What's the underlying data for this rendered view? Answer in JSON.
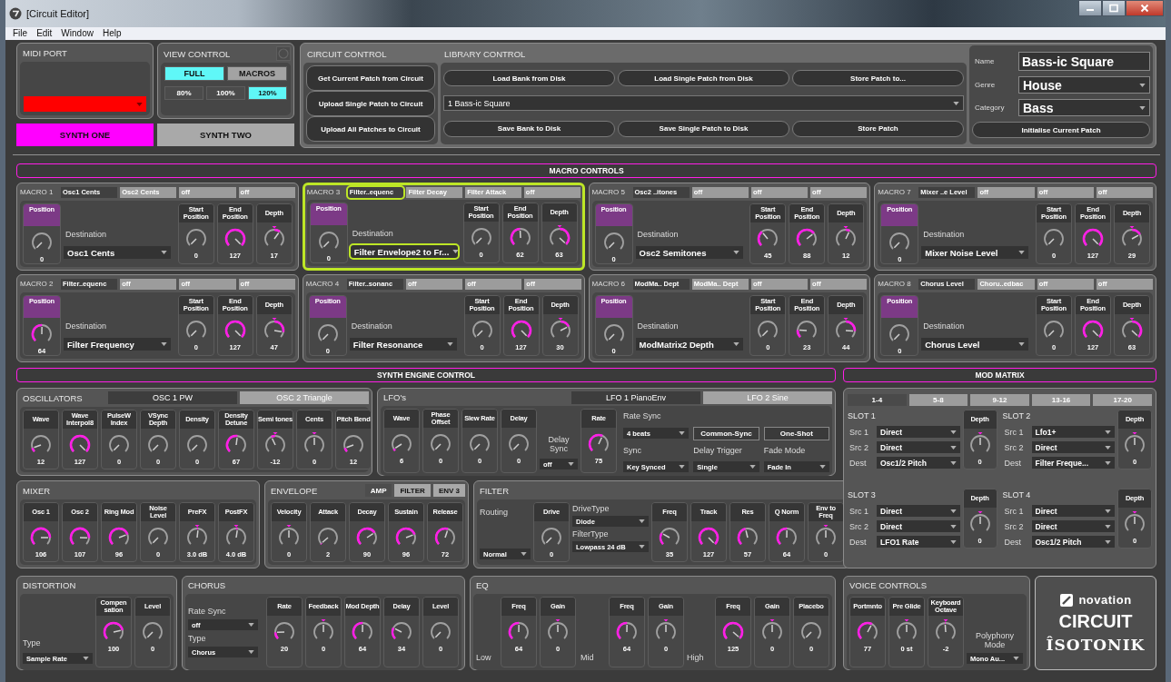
{
  "window": {
    "title": "[Circuit Editor]"
  },
  "menu": [
    "File",
    "Edit",
    "Window",
    "Help"
  ],
  "midi_port": {
    "title": "MIDI PORT"
  },
  "view_control": {
    "title": "VIEW CONTROL",
    "modes": [
      {
        "label": "FULL",
        "selected": true
      },
      {
        "label": "MACROS",
        "selected": false
      }
    ],
    "zoom": [
      {
        "label": "80%",
        "selected": false
      },
      {
        "label": "100%",
        "selected": false
      },
      {
        "label": "120%",
        "selected": true
      }
    ]
  },
  "synths": [
    {
      "label": "SYNTH ONE",
      "selected": true
    },
    {
      "label": "SYNTH TWO",
      "selected": false
    }
  ],
  "circuit_control": {
    "title": "CIRCUIT CONTROL",
    "buttons": [
      "Get Current Patch from Circuit",
      "Upload Single Patch to Circuit",
      "Upload All Patches to Circuit"
    ]
  },
  "library_control": {
    "title": "LIBRARY CONTROL",
    "buttons_top": [
      "Load Bank from Disk",
      "Load Single Patch from Disk",
      "Store Patch to..."
    ],
    "patch": "1 Bass-ic Square",
    "buttons_bottom": [
      "Save Bank to Disk",
      "Save Single Patch to Disk",
      "Store Patch"
    ]
  },
  "patch_info": {
    "name_label": "Name",
    "name": "Bass-ic Square",
    "genre_label": "Genre",
    "genre": "House",
    "category_label": "Category",
    "category": "Bass",
    "button": "Initialise Current Patch"
  },
  "macro_header": "MACRO CONTROLS",
  "macros": [
    {
      "title": "MACRO 1",
      "highlighted": false,
      "slots": [
        {
          "label": "Osc1 Cents",
          "selected": true
        },
        {
          "label": "Osc2 Cents",
          "selected": false
        },
        {
          "label": "off",
          "selected": false
        },
        {
          "label": "off",
          "selected": false
        }
      ],
      "position": {
        "label": "Position",
        "value": "0",
        "kind": "uni"
      },
      "destination_label": "Destination",
      "destination": "Osc1 Cents",
      "knobs": [
        {
          "label": "Start Position",
          "value": "0",
          "kind": "uni"
        },
        {
          "label": "End Position",
          "value": "127",
          "kind": "uni"
        },
        {
          "label": "Depth",
          "value": "17",
          "kind": "bi"
        }
      ]
    },
    {
      "title": "MACRO 3",
      "highlighted": true,
      "slots": [
        {
          "label": "Filter..equenc",
          "selected": true
        },
        {
          "label": "Filter Decay",
          "selected": false
        },
        {
          "label": "Filter Attack",
          "selected": false
        },
        {
          "label": "off",
          "selected": false
        }
      ],
      "position": {
        "label": "Position",
        "value": "0",
        "kind": "uni"
      },
      "destination_label": "Destination",
      "destination": "Filter Envelope2 to Fr...",
      "knobs": [
        {
          "label": "Start Position",
          "value": "0",
          "kind": "uni"
        },
        {
          "label": "End Position",
          "value": "62",
          "kind": "uni"
        },
        {
          "label": "Depth",
          "value": "63",
          "kind": "bi"
        }
      ]
    },
    {
      "title": "MACRO 5",
      "highlighted": false,
      "slots": [
        {
          "label": "Osc2 ..itones",
          "selected": true
        },
        {
          "label": "off",
          "selected": false
        },
        {
          "label": "off",
          "selected": false
        },
        {
          "label": "off",
          "selected": false
        }
      ],
      "position": {
        "label": "Position",
        "value": "0",
        "kind": "uni"
      },
      "destination_label": "Destination",
      "destination": "Osc2 Semitones",
      "knobs": [
        {
          "label": "Start Position",
          "value": "45",
          "kind": "uni"
        },
        {
          "label": "End Position",
          "value": "88",
          "kind": "uni"
        },
        {
          "label": "Depth",
          "value": "12",
          "kind": "bi"
        }
      ]
    },
    {
      "title": "MACRO 7",
      "highlighted": false,
      "slots": [
        {
          "label": "Mixer ..e Level",
          "selected": true
        },
        {
          "label": "off",
          "selected": false
        },
        {
          "label": "off",
          "selected": false
        },
        {
          "label": "off",
          "selected": false
        }
      ],
      "position": {
        "label": "Position",
        "value": "0",
        "kind": "uni"
      },
      "destination_label": "Destination",
      "destination": "Mixer Noise Level",
      "knobs": [
        {
          "label": "Start Position",
          "value": "0",
          "kind": "uni"
        },
        {
          "label": "End Position",
          "value": "127",
          "kind": "uni"
        },
        {
          "label": "Depth",
          "value": "29",
          "kind": "bi"
        }
      ]
    },
    {
      "title": "MACRO 2",
      "highlighted": false,
      "slots": [
        {
          "label": "Filter..equenc",
          "selected": true
        },
        {
          "label": "off",
          "selected": false
        },
        {
          "label": "off",
          "selected": false
        },
        {
          "label": "off",
          "selected": false
        }
      ],
      "position": {
        "label": "Position",
        "value": "64",
        "kind": "uni"
      },
      "destination_label": "Destination",
      "destination": "Filter Frequency",
      "knobs": [
        {
          "label": "Start Position",
          "value": "0",
          "kind": "uni"
        },
        {
          "label": "End Position",
          "value": "127",
          "kind": "uni"
        },
        {
          "label": "Depth",
          "value": "47",
          "kind": "bi"
        }
      ]
    },
    {
      "title": "MACRO 4",
      "highlighted": false,
      "slots": [
        {
          "label": "Filter..sonanc",
          "selected": true
        },
        {
          "label": "off",
          "selected": false
        },
        {
          "label": "off",
          "selected": false
        },
        {
          "label": "off",
          "selected": false
        }
      ],
      "position": {
        "label": "Position",
        "value": "0",
        "kind": "uni"
      },
      "destination_label": "Destination",
      "destination": "Filter Resonance",
      "knobs": [
        {
          "label": "Start Position",
          "value": "0",
          "kind": "uni"
        },
        {
          "label": "End Position",
          "value": "127",
          "kind": "uni"
        },
        {
          "label": "Depth",
          "value": "30",
          "kind": "bi"
        }
      ]
    },
    {
      "title": "MACRO 6",
      "highlighted": false,
      "slots": [
        {
          "label": "ModMa.. Dept",
          "selected": true
        },
        {
          "label": "ModMa.. Dept",
          "selected": false
        },
        {
          "label": "off",
          "selected": false
        },
        {
          "label": "off",
          "selected": false
        }
      ],
      "position": {
        "label": "Position",
        "value": "0",
        "kind": "uni"
      },
      "destination_label": "Destination",
      "destination": "ModMatrix2 Depth",
      "knobs": [
        {
          "label": "Start Position",
          "value": "0",
          "kind": "uni"
        },
        {
          "label": "End Position",
          "value": "23",
          "kind": "uni"
        },
        {
          "label": "Depth",
          "value": "44",
          "kind": "bi"
        }
      ]
    },
    {
      "title": "MACRO 8",
      "highlighted": false,
      "slots": [
        {
          "label": "Chorus Level",
          "selected": true
        },
        {
          "label": "Choru..edbac",
          "selected": false
        },
        {
          "label": "off",
          "selected": false
        },
        {
          "label": "off",
          "selected": false
        }
      ],
      "position": {
        "label": "Position",
        "value": "0",
        "kind": "uni"
      },
      "destination_label": "Destination",
      "destination": "Chorus Level",
      "knobs": [
        {
          "label": "Start Position",
          "value": "0",
          "kind": "uni"
        },
        {
          "label": "End Position",
          "value": "127",
          "kind": "uni"
        },
        {
          "label": "Depth",
          "value": "63",
          "kind": "bi"
        }
      ]
    }
  ],
  "engine_header": "SYNTH ENGINE CONTROL",
  "oscillators": {
    "title": "OSCILLATORS",
    "tabs": [
      {
        "label": "OSC 1 PW",
        "selected": true
      },
      {
        "label": "OSC 2 Triangle",
        "selected": false
      }
    ],
    "knobs": [
      {
        "label": "Wave",
        "value": "12",
        "kind": "uni"
      },
      {
        "label": "Wave Interpol8",
        "value": "127",
        "kind": "uni"
      },
      {
        "label": "PulseW Index",
        "value": "0",
        "kind": "uni"
      },
      {
        "label": "VSync Depth",
        "value": "0",
        "kind": "uni"
      },
      {
        "label": "Density",
        "value": "0",
        "kind": "uni"
      },
      {
        "label": "Density Detune",
        "value": "67",
        "kind": "uni"
      },
      {
        "label": "Semi tones",
        "value": "-12",
        "kind": "bi"
      },
      {
        "label": "Cents",
        "value": "0",
        "kind": "bi"
      },
      {
        "label": "Pitch Bend",
        "value": "12",
        "kind": "uni"
      }
    ]
  },
  "lfos": {
    "title": "LFO's",
    "tabs": [
      {
        "label": "LFO 1 PianoEnv",
        "selected": true
      },
      {
        "label": "LFO 2 Sine",
        "selected": false
      }
    ],
    "knobs": [
      {
        "label": "Wave",
        "value": "6",
        "kind": "uni"
      },
      {
        "label": "Phase Offset",
        "value": "0",
        "kind": "uni"
      },
      {
        "label": "Slew Rate",
        "value": "0",
        "kind": "uni"
      },
      {
        "label": "Delay",
        "value": "0",
        "kind": "uni"
      }
    ],
    "delay_sync": {
      "label": "Delay Sync",
      "value": "off"
    },
    "rate": {
      "label": "Rate",
      "value": "75",
      "kind": "uni"
    },
    "rate_sync": {
      "label": "Rate Sync",
      "value": "4 beats"
    },
    "buttons": [
      "Common-Sync",
      "One-Shot"
    ],
    "sync": {
      "label": "Sync",
      "value": "Key Synced"
    },
    "delay_trigger": {
      "label": "Delay Trigger",
      "value": "Single"
    },
    "fade_mode": {
      "label": "Fade Mode",
      "value": "Fade In"
    }
  },
  "mixer": {
    "title": "MIXER",
    "knobs": [
      {
        "label": "Osc 1",
        "value": "106",
        "kind": "uni"
      },
      {
        "label": "Osc 2",
        "value": "107",
        "kind": "uni"
      },
      {
        "label": "Ring Mod",
        "value": "96",
        "kind": "uni"
      },
      {
        "label": "Noise Level",
        "value": "0",
        "kind": "uni"
      },
      {
        "label": "PreFX",
        "value": "3.0 dB",
        "kind": "bi"
      },
      {
        "label": "PostFX",
        "value": "4.0 dB",
        "kind": "bi"
      }
    ]
  },
  "envelope": {
    "title": "ENVELOPE",
    "tabs": [
      {
        "label": "AMP",
        "selected": true
      },
      {
        "label": "FILTER",
        "selected": false
      },
      {
        "label": "ENV 3",
        "selected": false
      }
    ],
    "knobs": [
      {
        "label": "Velocity",
        "value": "0",
        "kind": "bi"
      },
      {
        "label": "Attack",
        "value": "2",
        "kind": "uni"
      },
      {
        "label": "Decay",
        "value": "90",
        "kind": "uni"
      },
      {
        "label": "Sustain",
        "value": "96",
        "kind": "uni"
      },
      {
        "label": "Release",
        "value": "72",
        "kind": "uni"
      }
    ]
  },
  "filter": {
    "title": "FILTER",
    "routing": {
      "label": "Routing",
      "value": "Normal"
    },
    "drive": {
      "label": "Drive",
      "value": "0",
      "kind": "uni"
    },
    "drive_type": {
      "label": "DriveType",
      "value": "Diode"
    },
    "filter_type": {
      "label": "FilterType",
      "value": "Lowpass 24 dB"
    },
    "knobs": [
      {
        "label": "Freq",
        "value": "35",
        "kind": "uni"
      },
      {
        "label": "Track",
        "value": "127",
        "kind": "uni"
      },
      {
        "label": "Res",
        "value": "57",
        "kind": "uni"
      },
      {
        "label": "Q Norm",
        "value": "64",
        "kind": "uni"
      },
      {
        "label": "Env to Freq",
        "value": "0",
        "kind": "bi"
      }
    ]
  },
  "distortion": {
    "title": "DISTORTION",
    "type": {
      "label": "Type",
      "value": "Sample Rate"
    },
    "knobs": [
      {
        "label": "Compen sation",
        "value": "100",
        "kind": "uni"
      },
      {
        "label": "Level",
        "value": "0",
        "kind": "uni"
      }
    ]
  },
  "chorus": {
    "title": "CHORUS",
    "rate_sync": {
      "label": "Rate Sync",
      "value": "off"
    },
    "type": {
      "label": "Type",
      "value": "Chorus"
    },
    "knobs": [
      {
        "label": "Rate",
        "value": "20",
        "kind": "uni"
      },
      {
        "label": "Feedback",
        "value": "0",
        "kind": "bi"
      },
      {
        "label": "Mod Depth",
        "value": "64",
        "kind": "uni"
      },
      {
        "label": "Delay",
        "value": "34",
        "kind": "uni"
      },
      {
        "label": "Level",
        "value": "0",
        "kind": "uni"
      }
    ]
  },
  "eq": {
    "title": "EQ",
    "bands": [
      {
        "label": "Low",
        "knobs": [
          {
            "label": "Freq",
            "value": "64",
            "kind": "uni"
          },
          {
            "label": "Gain",
            "value": "0",
            "kind": "bi"
          }
        ]
      },
      {
        "label": "Mid",
        "knobs": [
          {
            "label": "Freq",
            "value": "64",
            "kind": "uni"
          },
          {
            "label": "Gain",
            "value": "0",
            "kind": "bi"
          }
        ]
      },
      {
        "label": "High",
        "knobs": [
          {
            "label": "Freq",
            "value": "125",
            "kind": "uni"
          },
          {
            "label": "Gain",
            "value": "0",
            "kind": "bi"
          },
          {
            "label": "Placebo",
            "value": "0",
            "kind": "uni"
          }
        ]
      }
    ]
  },
  "mod_matrix_header": "MOD MATRIX",
  "mod_matrix": {
    "tabs": [
      {
        "label": "1-4",
        "selected": true
      },
      {
        "label": "5-8",
        "selected": false
      },
      {
        "label": "9-12",
        "selected": false
      },
      {
        "label": "13-16",
        "selected": false
      },
      {
        "label": "17-20",
        "selected": false
      }
    ],
    "slots": [
      {
        "title": "SLOT 1",
        "rows": [
          {
            "label": "Src 1",
            "value": "Direct"
          },
          {
            "label": "Src 2",
            "value": "Direct"
          },
          {
            "label": "Dest",
            "value": "Osc1/2 Pitch"
          }
        ],
        "depth": {
          "label": "Depth",
          "value": "0",
          "kind": "bi"
        }
      },
      {
        "title": "SLOT 2",
        "rows": [
          {
            "label": "Src 1",
            "value": "Lfo1+"
          },
          {
            "label": "Src 2",
            "value": "Direct"
          },
          {
            "label": "Dest",
            "value": "Filter Freque..."
          }
        ],
        "depth": {
          "label": "Depth",
          "value": "0",
          "kind": "bi"
        }
      },
      {
        "title": "SLOT 3",
        "rows": [
          {
            "label": "Src 1",
            "value": "Direct"
          },
          {
            "label": "Src 2",
            "value": "Direct"
          },
          {
            "label": "Dest",
            "value": "LFO1 Rate"
          }
        ],
        "depth": {
          "label": "Depth",
          "value": "0",
          "kind": "bi"
        }
      },
      {
        "title": "SLOT 4",
        "rows": [
          {
            "label": "Src 1",
            "value": "Direct"
          },
          {
            "label": "Src 2",
            "value": "Direct"
          },
          {
            "label": "Dest",
            "value": "Osc1/2 Pitch"
          }
        ],
        "depth": {
          "label": "Depth",
          "value": "0",
          "kind": "bi"
        }
      }
    ]
  },
  "voice_controls": {
    "title": "VOICE CONTROLS",
    "knobs": [
      {
        "label": "Portmnto",
        "value": "77",
        "kind": "uni"
      },
      {
        "label": "Pre Glide",
        "value": "0 st",
        "kind": "bi"
      },
      {
        "label": "Keyboard Octave",
        "value": "-2",
        "kind": "bi"
      }
    ],
    "polyphony": {
      "label": "Polyphony Mode",
      "value": "Mono Au..."
    }
  },
  "logo": {
    "brand": "novation",
    "product": "CIRCUIT",
    "maker": "ÎSOTONIK"
  }
}
